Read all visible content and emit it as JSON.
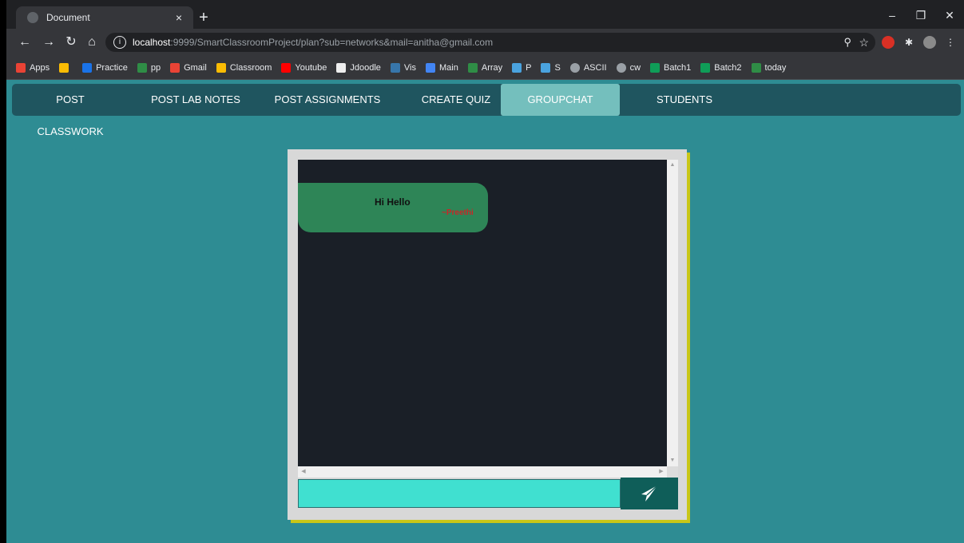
{
  "browser": {
    "tab_title": "Document",
    "tab_close": "×",
    "new_tab": "+",
    "url_host": "localhost",
    "url_rest": ":9999/SmartClassroomProject/plan?sub=networks&mail=anitha@gmail.com",
    "bookmarks": [
      "Apps",
      "",
      "Practice",
      "pp",
      "Gmail",
      "Classroom",
      "Youtube",
      "Jdoodle",
      "Vis",
      "Main",
      "Array",
      "P",
      "S",
      "ASCII",
      "cw",
      "Batch1",
      "Batch2",
      "today"
    ]
  },
  "nav": {
    "items": [
      "POST CLASSWORK",
      "POST LAB NOTES",
      "POST ASSIGNMENTS",
      "CREATE QUIZ",
      "GROUPCHAT",
      "STUDENTS"
    ],
    "active": "GROUPCHAT"
  },
  "chat": {
    "messages": [
      {
        "text": "Hi Hello",
        "sender": "~Preethi"
      }
    ],
    "input_value": "",
    "input_placeholder": ""
  },
  "colors": {
    "page_bg": "#2e8c93",
    "navbar_bg": "#1f555f",
    "nav_active_bg": "#74bfbd",
    "chat_bg": "#1a1f27",
    "bubble_bg": "#2e8557",
    "sender_color": "#c62828",
    "input_bg": "#40e0d0",
    "send_button_bg": "#0f5e59",
    "frame_shadow": "#c9c617"
  }
}
